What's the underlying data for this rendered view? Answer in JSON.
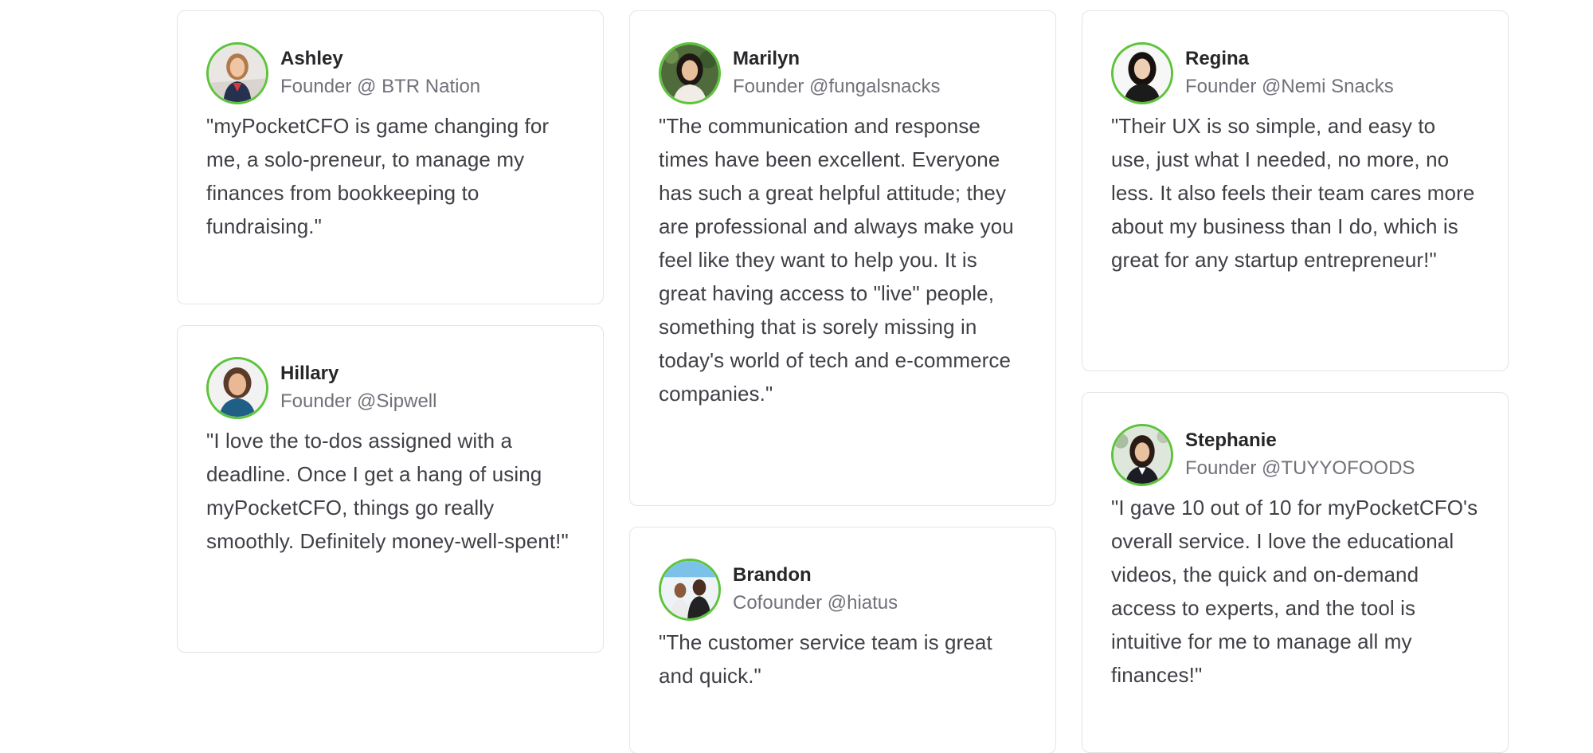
{
  "testimonials": [
    {
      "name": "Ashley",
      "role": "Founder @ BTR Nation",
      "quote": "\"myPocketCFO is game changing for me, a solo-preneur, to manage my finances from bookkeeping to fundraising.\""
    },
    {
      "name": "Hillary",
      "role": "Founder @Sipwell",
      "quote": "\"I love the to-dos assigned with a deadline. Once I get a hang of using myPocketCFO, things go really smoothly. Definitely money-well-spent!\""
    },
    {
      "name": "Marilyn",
      "role": "Founder @fungalsnacks",
      "quote": "\"The communication and response times have been excellent. Everyone has such a great helpful attitude; they are professional and always make you feel like they want to help you. It is great having access to \"live\" people, something that is sorely missing in today's world of tech and e-commerce companies.\""
    },
    {
      "name": "Brandon",
      "role": "Cofounder @hiatus",
      "quote": "\"The customer service team is great and quick.\""
    },
    {
      "name": "Regina",
      "role": "Founder @Nemi Snacks",
      "quote": "\"Their UX is so simple, and easy to use, just what I needed, no more, no less. It also feels their team cares more about my business than I do, which is great for any startup entrepreneur!\""
    },
    {
      "name": "Stephanie",
      "role": "Founder @TUYYOFOODS",
      "quote": "\"I gave 10 out of 10 for myPocketCFO's overall service. I love the educational videos, the quick and on-demand access to experts, and the tool is intuitive for me to manage all my finances!\""
    }
  ],
  "colors": {
    "avatar_ring": "#5cc43a",
    "card_border": "#e4e4e7",
    "name_text": "#27272a",
    "role_text": "#71717a",
    "quote_text": "#3f3f46"
  }
}
